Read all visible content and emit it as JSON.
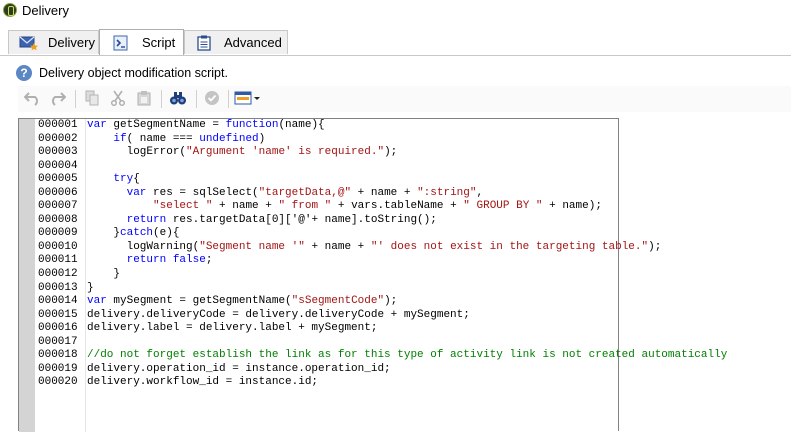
{
  "window": {
    "title": "Delivery",
    "icon": "app-leaf-icon"
  },
  "tabs": [
    {
      "label": "Delivery",
      "icon": "envelope-star-icon",
      "active": false
    },
    {
      "label": "Script",
      "icon": "script-icon",
      "active": true
    },
    {
      "label": "Advanced",
      "icon": "clipboard-icon",
      "active": false
    }
  ],
  "info": {
    "text": "Delivery object modification script.",
    "icon": "help-icon"
  },
  "toolbar": {
    "buttons": [
      "undo",
      "redo",
      "copy",
      "cut",
      "paste",
      "find",
      "check-syntax",
      "insert-field"
    ]
  },
  "editor": {
    "line_numbers": [
      "000001",
      "000002",
      "000003",
      "000004",
      "000005",
      "000006",
      "000007",
      "000008",
      "000009",
      "000010",
      "000011",
      "000012",
      "000013",
      "000014",
      "000015",
      "000016",
      "000017",
      "000018",
      "000019",
      "000020"
    ],
    "lines": [
      "var getSegmentName = function(name){",
      "    if( name === undefined)",
      "      logError(\"Argument 'name' is required.\");",
      "",
      "    try{",
      "      var res = sqlSelect(\"targetData,@\" + name + \":string\",",
      "          \"select \" + name + \" from \" + vars.tableName + \" GROUP BY \" + name);",
      "      return res.targetData[0]['@'+ name].toString();",
      "    }catch(e){",
      "      logWarning(\"Segment name '\" + name + \"' does not exist in the targeting table.\");",
      "      return false;",
      "    }",
      "}",
      "var mySegment = getSegmentName(\"sSegmentCode\");",
      "delivery.deliveryCode = delivery.deliveryCode + mySegment;",
      "delivery.label = delivery.label + mySegment;",
      "",
      "//do not forget establish the link as for this type of activity link is not created automatically",
      "delivery.operation_id = instance.operation_id;",
      "delivery.workflow_id = instance.id;"
    ]
  },
  "colors": {
    "keyword": "#0000ff",
    "string": "#a31515",
    "comment": "#008000",
    "gutter": "#d4d4d4"
  }
}
